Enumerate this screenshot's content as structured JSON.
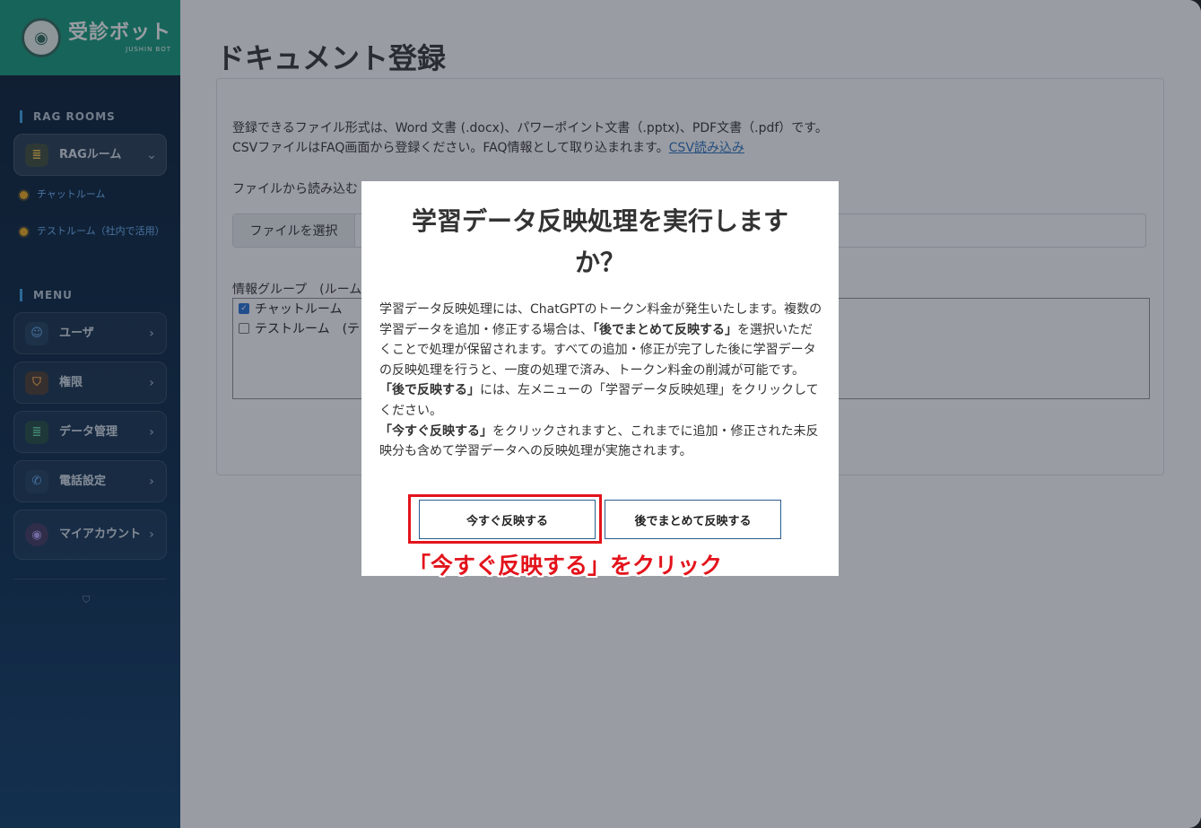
{
  "brand": {
    "title": "受診ボット",
    "subtitle": "JUSHIN BOT",
    "logo_icon": "robot-logo"
  },
  "sidebar": {
    "rag_section": "RAG ROOMS",
    "rag_room": {
      "label": "RAGルーム",
      "icon": "database-icon"
    },
    "rooms": [
      {
        "label": "チャットルーム"
      },
      {
        "label": "テストルーム（社内で活用）"
      }
    ],
    "menu_section": "MENU",
    "items": [
      {
        "label": "ユーザ",
        "icon": "user-icon"
      },
      {
        "label": "権限",
        "icon": "shield-icon"
      },
      {
        "label": "データ管理",
        "icon": "database-icon"
      },
      {
        "label": "電話設定",
        "icon": "phone-icon"
      },
      {
        "label": "マイアカウント",
        "icon": "account-icon"
      }
    ]
  },
  "main": {
    "title": "ドキュメント登録",
    "desc_line1": "登録できるファイル形式は、Word 文書 (.docx)、パワーポイント文書（.pptx)、PDF文書（.pdf）です。",
    "desc_line2": "CSVファイルはFAQ画面から登録ください。FAQ情報として取り込まれます。",
    "csv_link": "CSV読み込み",
    "file_label": "ファイルから読み込む",
    "file_button": "ファイルを選択",
    "group_label": "情報グループ　(ルーム",
    "groups": [
      {
        "label": "チャットルーム",
        "checked": true
      },
      {
        "label": "テストルーム　(テ",
        "checked": false
      }
    ]
  },
  "modal": {
    "title": "学習データ反映処理を実行しますか？",
    "p1": "学習データ反映処理には、ChatGPTのトークン料金が発生いたします。複数の学習データを追加・修正する場合は、",
    "p1_bold": "「後でまとめて反映する」",
    "p1_rest": "を選択いただくことで処理が保留されます。すべての追加・修正が完了した後に学習データの反映処理を行うと、一度の処理で済み、トークン料金の削減が可能です。",
    "p2_bold": "「後で反映する」",
    "p2_rest": "には、左メニューの「学習データ反映処理」をクリックしてください。",
    "p3_bold": "「今すぐ反映する」",
    "p3_rest": "をクリックされますと、これまでに追加・修正された未反映分も含めて学習データへの反映処理が実施されます。",
    "btn_now": "今すぐ反映する",
    "btn_later": "後でまとめて反映する"
  },
  "annotation": {
    "text": "「今すぐ反映する」をクリック",
    "color": "#e3131b"
  },
  "colors": {
    "brand": "#139b7c",
    "accent": "#3aa2e6",
    "sidebar": "#08284a"
  }
}
